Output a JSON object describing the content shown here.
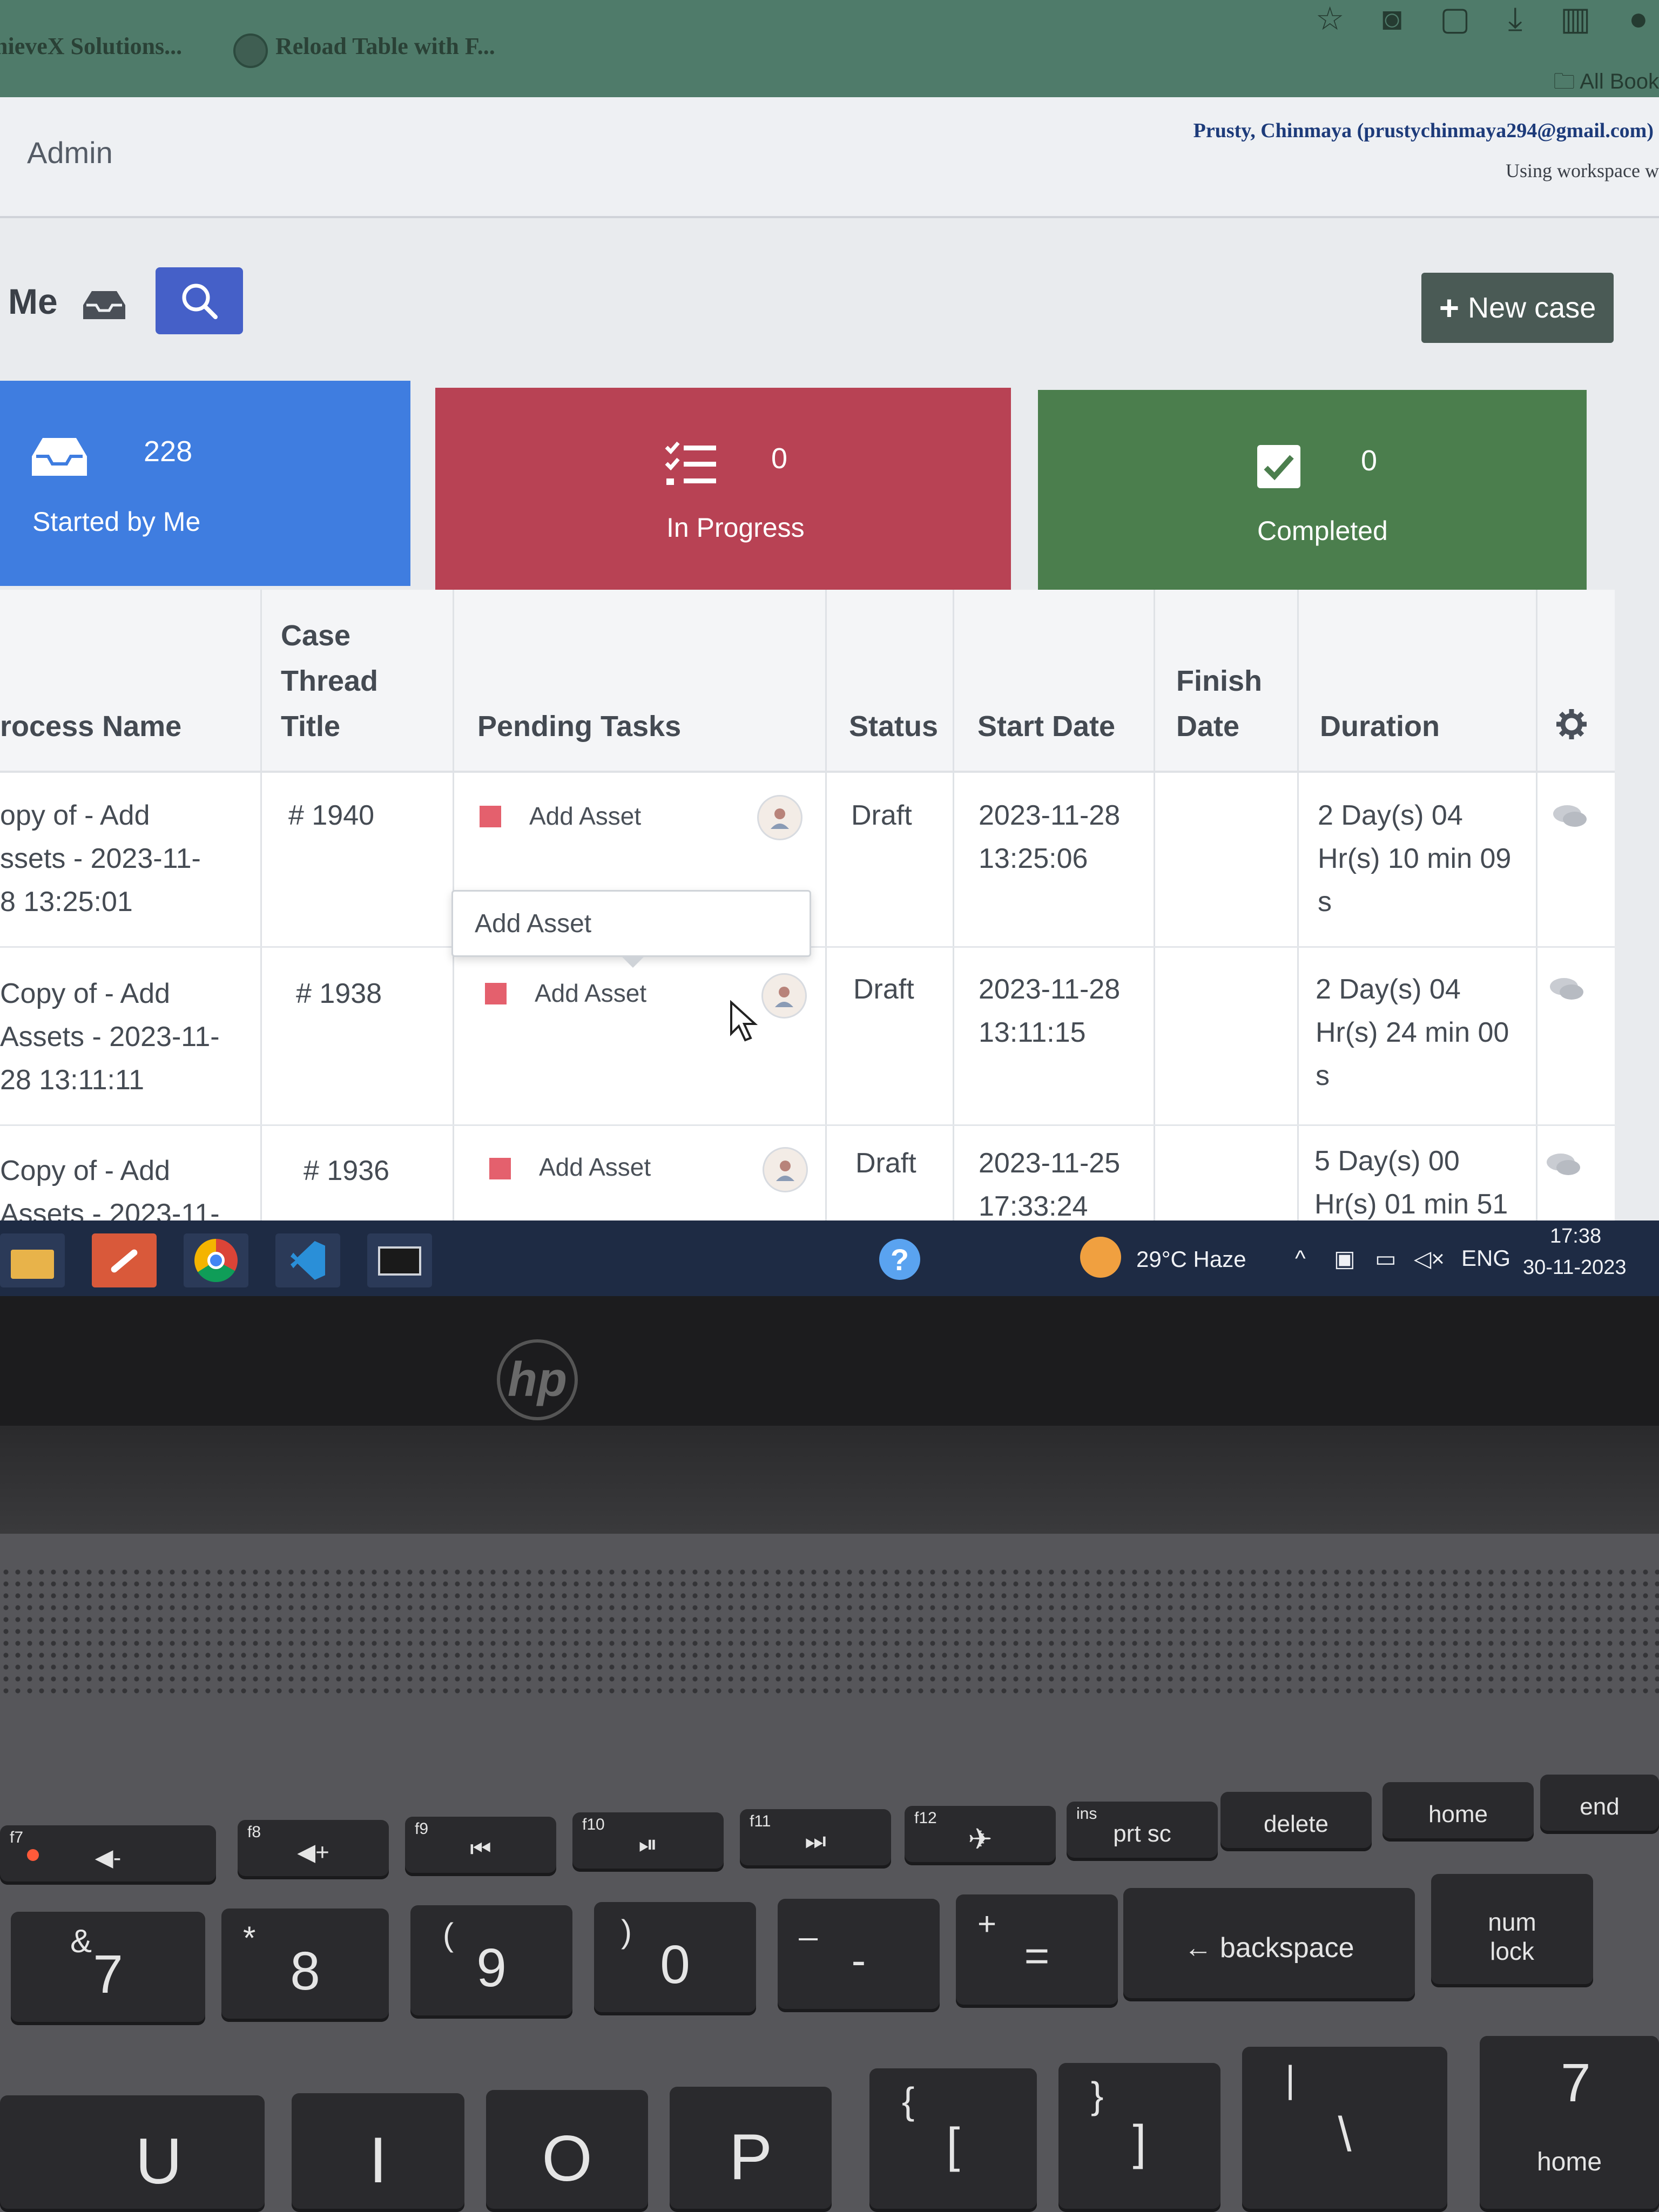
{
  "browser": {
    "tabs": [
      "hieveX Solutions...",
      "Reload Table with F..."
    ],
    "bookmarks_label": "All Book"
  },
  "header": {
    "section": "Admin",
    "user": "Prusty, Chinmaya (prustychinmaya294@gmail.com)",
    "workspace": "Using workspace w"
  },
  "toolbar": {
    "me_label": "Me",
    "new_case_label": "New case"
  },
  "cards": {
    "started": {
      "count": "228",
      "label": "Started by Me"
    },
    "in_progress": {
      "count": "0",
      "label": "In Progress"
    },
    "completed": {
      "count": "0",
      "label": "Completed"
    }
  },
  "table": {
    "headers": {
      "process_name": "rocess Name",
      "case_thread_line1": "Case",
      "case_thread_line2": "Thread",
      "case_thread_line3": "Title",
      "pending_tasks": "Pending Tasks",
      "status": "Status",
      "start_date": "Start Date",
      "finish_line1": "Finish",
      "finish_line2": "Date",
      "duration": "Duration"
    },
    "rows": [
      {
        "process_l1": "opy of - Add",
        "process_l2": "ssets - 2023-11-",
        "process_l3": "8 13:25:01",
        "thread": "# 1940",
        "task": "Add Asset",
        "status": "Draft",
        "start_l1": "2023-11-28",
        "start_l2": "13:25:06",
        "dur_l1": "2 Day(s) 04",
        "dur_l2": "Hr(s) 10 min 09",
        "dur_l3": "s"
      },
      {
        "process_l1": "Copy of - Add",
        "process_l2": "Assets - 2023-11-",
        "process_l3": "28 13:11:11",
        "thread": "# 1938",
        "task": "Add Asset",
        "status": "Draft",
        "start_l1": "2023-11-28",
        "start_l2": "13:11:15",
        "dur_l1": "2 Day(s) 04",
        "dur_l2": "Hr(s) 24 min 00",
        "dur_l3": "s"
      },
      {
        "process_l1": "Copy of - Add",
        "process_l2": "Assets - 2023-11-",
        "thread": "# 1936",
        "task": "Add Asset",
        "status": "Draft",
        "start_l1": "2023-11-25",
        "start_l2": "17:33:24",
        "dur_l1": "5 Day(s) 00",
        "dur_l2": "Hr(s) 01 min 51"
      }
    ],
    "tooltip": "Add Asset"
  },
  "taskbar": {
    "weather": "29°C  Haze",
    "language": "ENG",
    "time": "17:38",
    "date": "30-11-2023"
  },
  "keyboard": {
    "fn_row": [
      {
        "top": "f7",
        "main": "◀-"
      },
      {
        "top": "f8",
        "main": "◀+"
      },
      {
        "top": "f9",
        "main": "⏮"
      },
      {
        "top": "f10",
        "main": "⏯"
      },
      {
        "top": "f11",
        "main": "⏭"
      },
      {
        "top": "f12",
        "main": "✈"
      },
      {
        "top": "ins",
        "main": "prt sc"
      },
      {
        "top": "",
        "main": "delete"
      },
      {
        "top": "",
        "main": "home"
      },
      {
        "top": "",
        "main": "end"
      }
    ],
    "num_row": [
      {
        "top": "&",
        "main": "7"
      },
      {
        "top": "*",
        "main": "8"
      },
      {
        "top": "(",
        "main": "9"
      },
      {
        "top": ")",
        "main": "0"
      },
      {
        "top": "_",
        "main": "-"
      },
      {
        "top": "+",
        "main": "="
      },
      {
        "top": "",
        "main": "←  backspace"
      },
      {
        "top": "",
        "main": "num lock"
      }
    ],
    "letter_row": [
      {
        "top": "",
        "main": "U"
      },
      {
        "top": "",
        "main": "I"
      },
      {
        "top": "",
        "main": "O"
      },
      {
        "top": "",
        "main": "P"
      },
      {
        "top": "{",
        "main": "["
      },
      {
        "top": "}",
        "main": "]"
      },
      {
        "top": "|",
        "main": "\\"
      },
      {
        "top": "7",
        "main": "home"
      }
    ]
  },
  "colors": {
    "started": "#3f7de0",
    "in_progress": "#b84254",
    "completed": "#4b7e4d",
    "search": "#4560c8",
    "task_marker": "#e4606d"
  }
}
